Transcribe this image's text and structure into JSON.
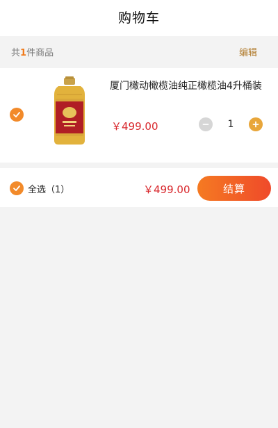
{
  "header": {
    "title": "购物车"
  },
  "summary": {
    "prefix": "共",
    "count": "1",
    "suffix": "件商品",
    "edit_label": "编辑"
  },
  "item": {
    "name": "厦门橄动橄榄油纯正橄榄油4升桶装",
    "price": "￥499.00",
    "quantity": "1",
    "minus_icon": "minus-icon",
    "plus_icon": "plus-icon",
    "checked": true
  },
  "footer": {
    "select_all_label": "全选（1）",
    "total": "￥499.00",
    "checkout_label": "结算"
  },
  "colors": {
    "accent": "#f28a2a",
    "price": "#d8262b",
    "checkout_start": "#f57a22",
    "checkout_end": "#ef4a2a"
  }
}
